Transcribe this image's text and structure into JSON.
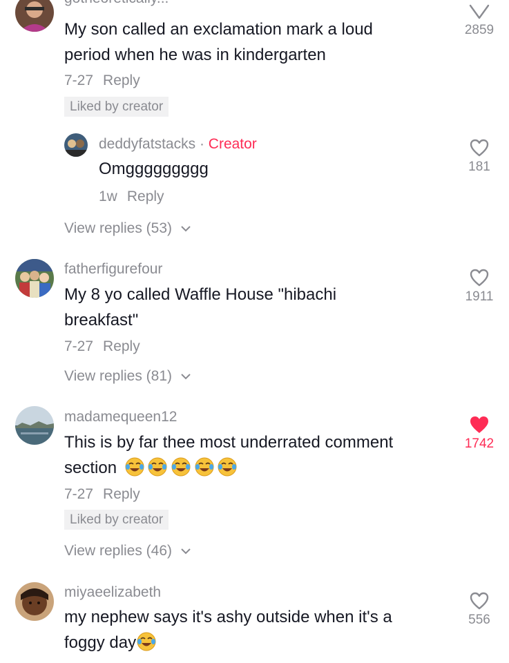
{
  "comments": [
    {
      "username": "gotheoretically...",
      "text_line1": "My son called an exclamation mark a loud",
      "text_line2": "period when he was in kindergarten",
      "date": "7-27",
      "reply_label": "Reply",
      "liked_by_creator": "Liked by creator",
      "like_count": "2859",
      "reply": {
        "username": "deddyfatstacks",
        "separator": "·",
        "creator_label": "Creator",
        "text": "Omggggggggg",
        "date": "1w",
        "reply_label": "Reply",
        "like_count": "181"
      },
      "view_replies": "View replies (53)"
    },
    {
      "username": "fatherfigurefour",
      "text_line1": "My 8 yo called Waffle House \"hibachi",
      "text_line2": "breakfast\"",
      "date": "7-27",
      "reply_label": "Reply",
      "like_count": "1911",
      "view_replies": "View replies (81)"
    },
    {
      "username": "madamequeen12",
      "text_line1": "This is by far thee most underrated comment",
      "text_line2": "section",
      "emoji": "😂😂😂😂😂",
      "date": "7-27",
      "reply_label": "Reply",
      "liked_by_creator": "Liked by creator",
      "like_count": "1742",
      "liked": true,
      "view_replies": "View replies (46)"
    },
    {
      "username": "miyaeelizabeth",
      "text_line1": "my nephew says it's ashy outside when it's a",
      "text_line2": "foggy day",
      "emoji": "😂",
      "like_count": "556"
    }
  ],
  "colors": {
    "text": "#161823",
    "muted": "#8a8b91",
    "accent": "#fe2c55",
    "chip_bg": "#f1f1f2"
  },
  "icons": {
    "like": "heart-outline-icon",
    "liked": "heart-filled-icon",
    "expand": "chevron-down-icon",
    "laugh": "tears-of-joy-emoji"
  }
}
